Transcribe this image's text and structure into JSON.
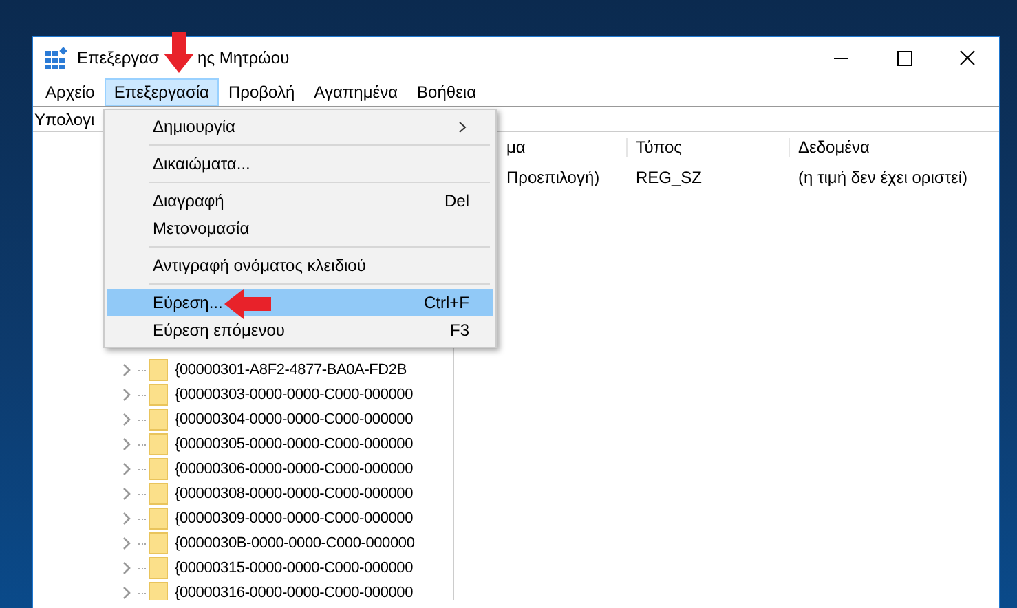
{
  "window": {
    "title_start": "Επεξεργασ",
    "title_end": "ης Μητρώου"
  },
  "menu_bar": [
    {
      "label": "Αρχείο",
      "selected": false
    },
    {
      "label": "Επεξεργασία",
      "selected": true
    },
    {
      "label": "Προβολή",
      "selected": false
    },
    {
      "label": "Αγαπημένα",
      "selected": false
    },
    {
      "label": "Βοήθεια",
      "selected": false
    }
  ],
  "address_bar": {
    "value": "Υπολογι"
  },
  "tree": {
    "items": [
      {
        "label": "{00000301-A8F2-4877-BA0A-FD2B"
      },
      {
        "label": "{00000303-0000-0000-C000-000000"
      },
      {
        "label": "{00000304-0000-0000-C000-000000"
      },
      {
        "label": "{00000305-0000-0000-C000-000000"
      },
      {
        "label": "{00000306-0000-0000-C000-000000"
      },
      {
        "label": "{00000308-0000-0000-C000-000000"
      },
      {
        "label": "{00000309-0000-0000-C000-000000"
      },
      {
        "label": "{0000030B-0000-0000-C000-000000"
      },
      {
        "label": "{00000315-0000-0000-C000-000000"
      },
      {
        "label": "{00000316-0000-0000-C000-000000"
      }
    ]
  },
  "list": {
    "columns": [
      "μα",
      "Τύπος",
      "Δεδομένα"
    ],
    "rows": [
      [
        "Προεπιλογή)",
        "REG_SZ",
        "(η τιμή δεν έχει οριστεί)"
      ]
    ]
  },
  "edit_menu": {
    "items": [
      {
        "kind": "item",
        "label": "Δημιουργία",
        "submenu": true,
        "selected": false
      },
      {
        "kind": "separator"
      },
      {
        "kind": "item",
        "label": "Δικαιώματα...",
        "selected": false
      },
      {
        "kind": "separator"
      },
      {
        "kind": "item",
        "label": "Διαγραφή",
        "shortcut": "Del",
        "selected": false
      },
      {
        "kind": "item",
        "label": "Μετονομασία",
        "selected": false
      },
      {
        "kind": "separator"
      },
      {
        "kind": "item",
        "label": "Αντιγραφή ονόματος κλειδιού",
        "selected": false
      },
      {
        "kind": "separator"
      },
      {
        "kind": "item",
        "label": "Εύρεση...",
        "shortcut": "Ctrl+F",
        "selected": true
      },
      {
        "kind": "item",
        "label": "Εύρεση επόμενου",
        "shortcut": "F3",
        "selected": false
      }
    ]
  }
}
